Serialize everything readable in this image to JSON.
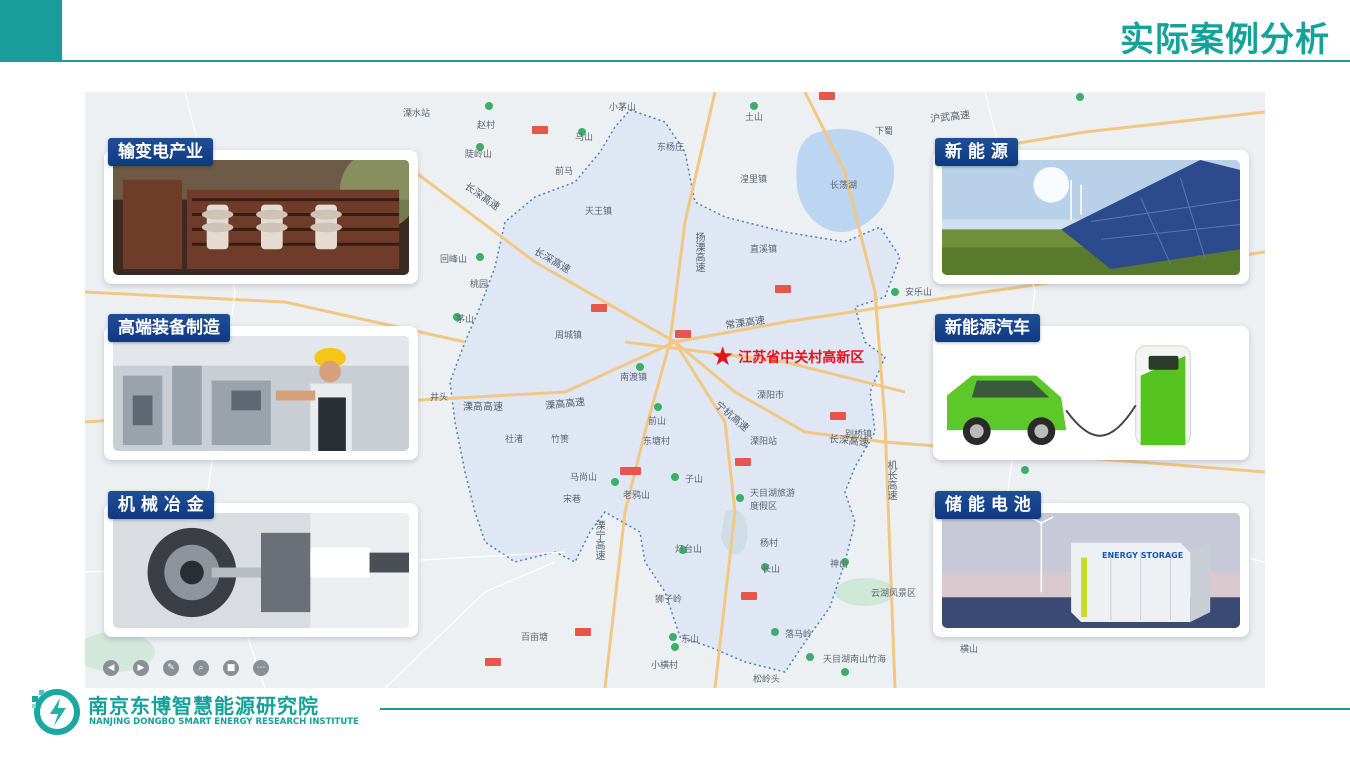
{
  "slide": {
    "title": "实际案例分析"
  },
  "map": {
    "target_label": "江苏省中关村高新区",
    "places": [
      "溧水站",
      "赵村",
      "马山",
      "东杨庄",
      "小茅山",
      "土山",
      "下蜀",
      "长荡湖",
      "湟里镇",
      "前马",
      "陡岭山",
      "吉山",
      "回峰山",
      "桃园",
      "南渡镇",
      "周城镇",
      "茅山",
      "天王镇",
      "直溪镇",
      "丫髻山",
      "井头",
      "别桥镇",
      "社渚",
      "竹箦",
      "前山",
      "东塘村",
      "溧阳市",
      "溧阳站",
      "马尚山",
      "子山",
      "老鸦山",
      "天目湖旅游度假区",
      "宋巷",
      "杨村",
      "神山",
      "长山",
      "灯台山",
      "狮子岭",
      "东山",
      "落马岭",
      "天目湖南山竹海",
      "松岭头",
      "百亩塘",
      "小横村",
      "云湖风景区",
      "安乐山",
      "横山",
      "上兴镇",
      "南山竹海",
      "溧阳"
    ],
    "roads": [
      "长深高速",
      "长深高速",
      "扬溧高速",
      "常溧高速",
      "溧高高速",
      "溧高高速",
      "长深高速",
      "宁杭高速",
      "溧宁高速",
      "机长高速",
      "沪武高速",
      "沪蓉高速"
    ]
  },
  "cards": {
    "left": [
      {
        "label": "输变电产业",
        "icon": "transformer-photo"
      },
      {
        "label": "高端装备制造",
        "icon": "factory-worker-photo"
      },
      {
        "label": "机 械 冶 金",
        "icon": "lathe-machine-photo"
      }
    ],
    "right": [
      {
        "label": "新  能  源",
        "icon": "solar-panel-photo"
      },
      {
        "label": "新能源汽车",
        "icon": "ev-charging-photo"
      },
      {
        "label": "储 能 电 池",
        "icon": "energy-storage-photo"
      }
    ],
    "storage_text": "ENERGY STORAGE"
  },
  "footer": {
    "org_cn": "南京东博智慧能源研究院",
    "org_en": "NANJING DONGBO SMART ENERGY RESEARCH INSTITUTE"
  },
  "colors": {
    "accent": "#1a9c9a",
    "badge": "#1f4e99",
    "target": "#e8101a"
  }
}
